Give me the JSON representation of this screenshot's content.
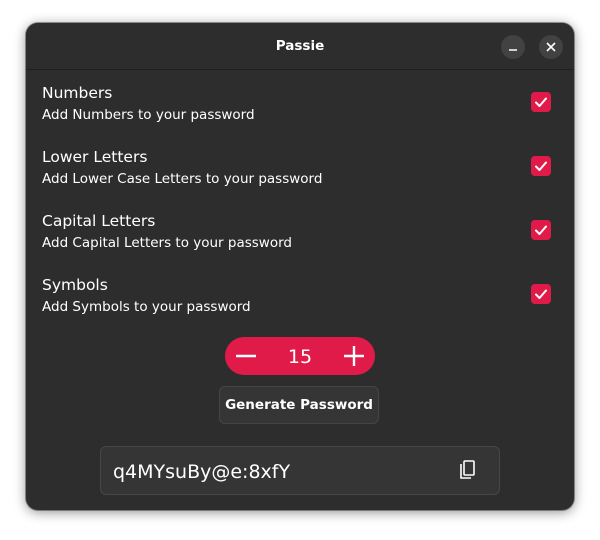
{
  "window": {
    "title": "Passie",
    "controls": {
      "minimize_icon": "minimize-icon",
      "close_icon": "close-icon"
    }
  },
  "options": [
    {
      "title": "Numbers",
      "subtitle": "Add Numbers to your password",
      "checked": true
    },
    {
      "title": "Lower Letters",
      "subtitle": "Add Lower Case Letters to your password",
      "checked": true
    },
    {
      "title": "Capital Letters",
      "subtitle": "Add Capital Letters to your password",
      "checked": true
    },
    {
      "title": "Symbols",
      "subtitle": "Add Symbols to your password",
      "checked": true
    }
  ],
  "length": {
    "value": "15",
    "decrement_icon": "minus-icon",
    "increment_icon": "plus-icon"
  },
  "generate_label": "Generate Password",
  "password": {
    "value": "q4MYsuBy@e:8xfY",
    "copy_icon": "copy-icon"
  },
  "colors": {
    "accent": "#e01b4a",
    "window_bg": "#2d2d2d",
    "button_bg": "#353535",
    "text": "#ffffff"
  }
}
